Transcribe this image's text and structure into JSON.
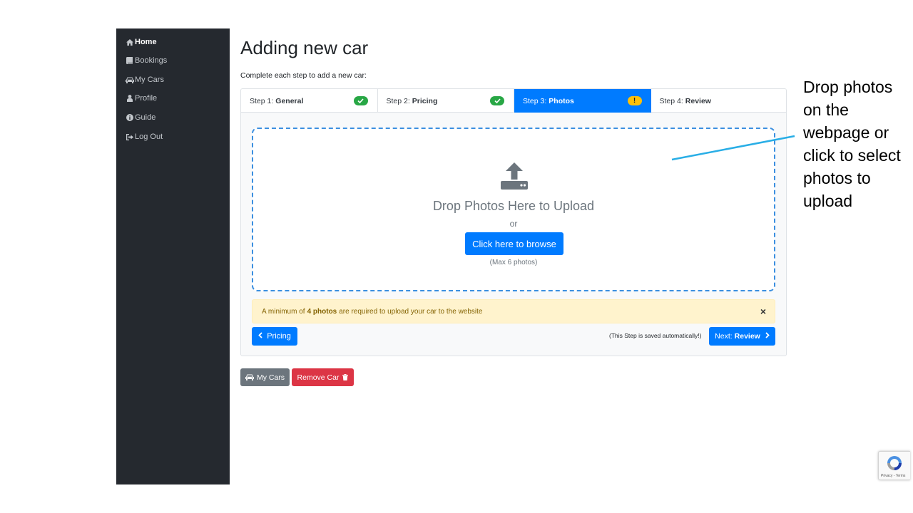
{
  "sidebar": {
    "items": [
      {
        "label": "Home",
        "icon": "home-icon",
        "active": true
      },
      {
        "label": "Bookings",
        "icon": "book-icon"
      },
      {
        "label": "My Cars",
        "icon": "car-icon"
      },
      {
        "label": "Profile",
        "icon": "user-icon"
      },
      {
        "label": "Guide",
        "icon": "info-icon"
      },
      {
        "label": "Log Out",
        "icon": "logout-icon"
      }
    ]
  },
  "page": {
    "title": "Adding new car",
    "subtitle": "Complete each step to add a new car:"
  },
  "steps": [
    {
      "prefix": "Step 1:",
      "name": "General",
      "status": "complete"
    },
    {
      "prefix": "Step 2:",
      "name": "Pricing",
      "status": "complete"
    },
    {
      "prefix": "Step 3:",
      "name": "Photos",
      "status": "warning",
      "active": true
    },
    {
      "prefix": "Step 4:",
      "name": "Review",
      "status": "none"
    }
  ],
  "dropzone": {
    "title": "Drop Photos Here to Upload",
    "or": "or",
    "browse_label": "Click here to browse",
    "max_note": "(Max 6 photos)"
  },
  "alert": {
    "before": "A minimum of",
    "bold": "4 photos",
    "after": "are required to upload your car to the website",
    "close": "×"
  },
  "footer": {
    "prev_label": "Pricing",
    "saved_note": "(This Step is saved automatically!)",
    "next_prefix": "Next:",
    "next_bold": "Review"
  },
  "actions": {
    "my_cars_label": "My Cars",
    "remove_label": "Remove Car"
  },
  "recaptcha": {
    "terms": "Privacy - Terms"
  },
  "annotation": {
    "text": "Drop photos on the webpage or click to select photos to upload",
    "color": "#29aee6"
  },
  "colors": {
    "sidebar_bg": "#25292f",
    "primary": "#007bff",
    "success": "#28a745",
    "warning": "#ffc107",
    "danger": "#dc3545",
    "secondary": "#6c757d"
  }
}
